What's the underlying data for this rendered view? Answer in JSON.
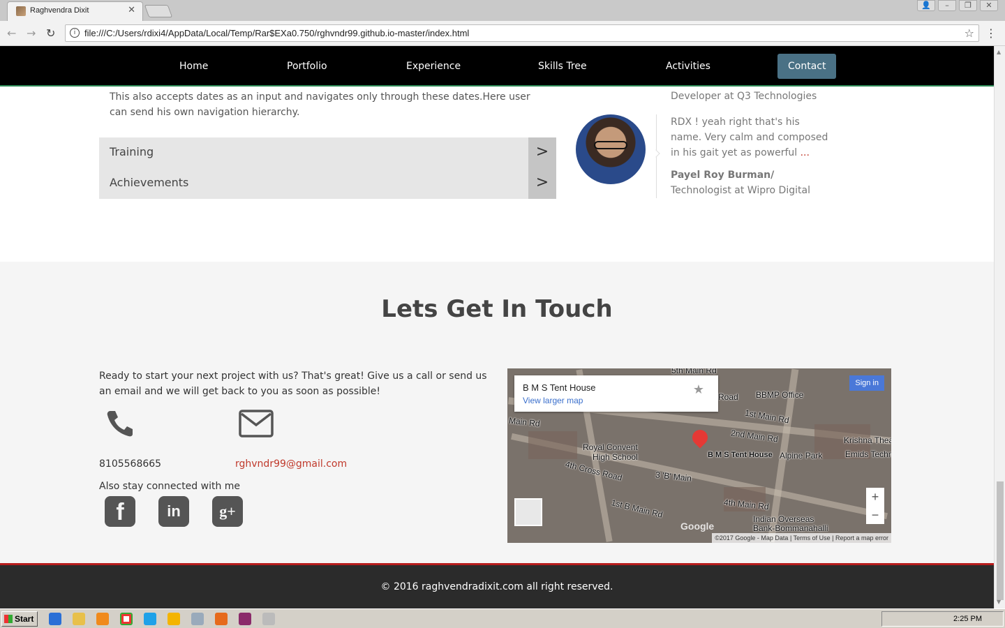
{
  "browser": {
    "tab_title": "Raghvendra Dixit",
    "url": "file:///C:/Users/rdixi4/AppData/Local/Temp/Rar$EXa0.750/rghvndr99.github.io-master/index.html"
  },
  "nav": {
    "items": [
      "Home",
      "Portfolio",
      "Experience",
      "Skills Tree",
      "Activities",
      "Contact"
    ],
    "active": "Contact"
  },
  "experience": {
    "description": "This also accepts dates as an input and navigates only through these dates.Here user can send his own navigation hierarchy.",
    "accordion": [
      "Training",
      "Achievements"
    ]
  },
  "testimonial": {
    "prev_author_role": "Developer at Q3 Technologies",
    "quote": "RDX ! yeah right that's his name. Very calm and composed in his gait yet as powerful",
    "more": "...",
    "author_name": "Payel Roy Burman/",
    "author_role": "Technologist at Wipro Digital"
  },
  "contact": {
    "title": "Lets Get In Touch",
    "intro": "Ready to start your next project with us? That's great! Give us a call or send us an email and we will get back to you as soon as possible!",
    "phone": "8105568665",
    "email": "rghvndr99@gmail.com",
    "also": "Also stay connected with me",
    "social": [
      "facebook-icon",
      "linkedin-icon",
      "googleplus-icon"
    ]
  },
  "map": {
    "place": "B M S Tent House",
    "larger_map": "View larger map",
    "sign_in": "Sign in",
    "labels": [
      "5th Main Rd",
      "Road",
      "BBMP Office",
      "1st Main Rd",
      "Main Rd",
      "2nd Main Rd",
      "Krishna Theatre",
      "Royal Convent",
      "High School",
      "B M S Tent House",
      "Alpine Park",
      "Emids Techno",
      "4th Cross Road",
      "3 'B' Main",
      "1st B Main Rd",
      "4th Main Rd",
      "Indian Overseas",
      "Bank-Bommanahalli"
    ],
    "zoom_in": "+",
    "zoom_out": "−",
    "logo": "Google",
    "footer": "©2017 Google - Map Data  |  Terms of Use  |  Report a map error"
  },
  "footer": {
    "text": "© 2016 raghvendradixit.com all right reserved."
  },
  "taskbar": {
    "start": "Start",
    "clock": "2:25 PM"
  }
}
